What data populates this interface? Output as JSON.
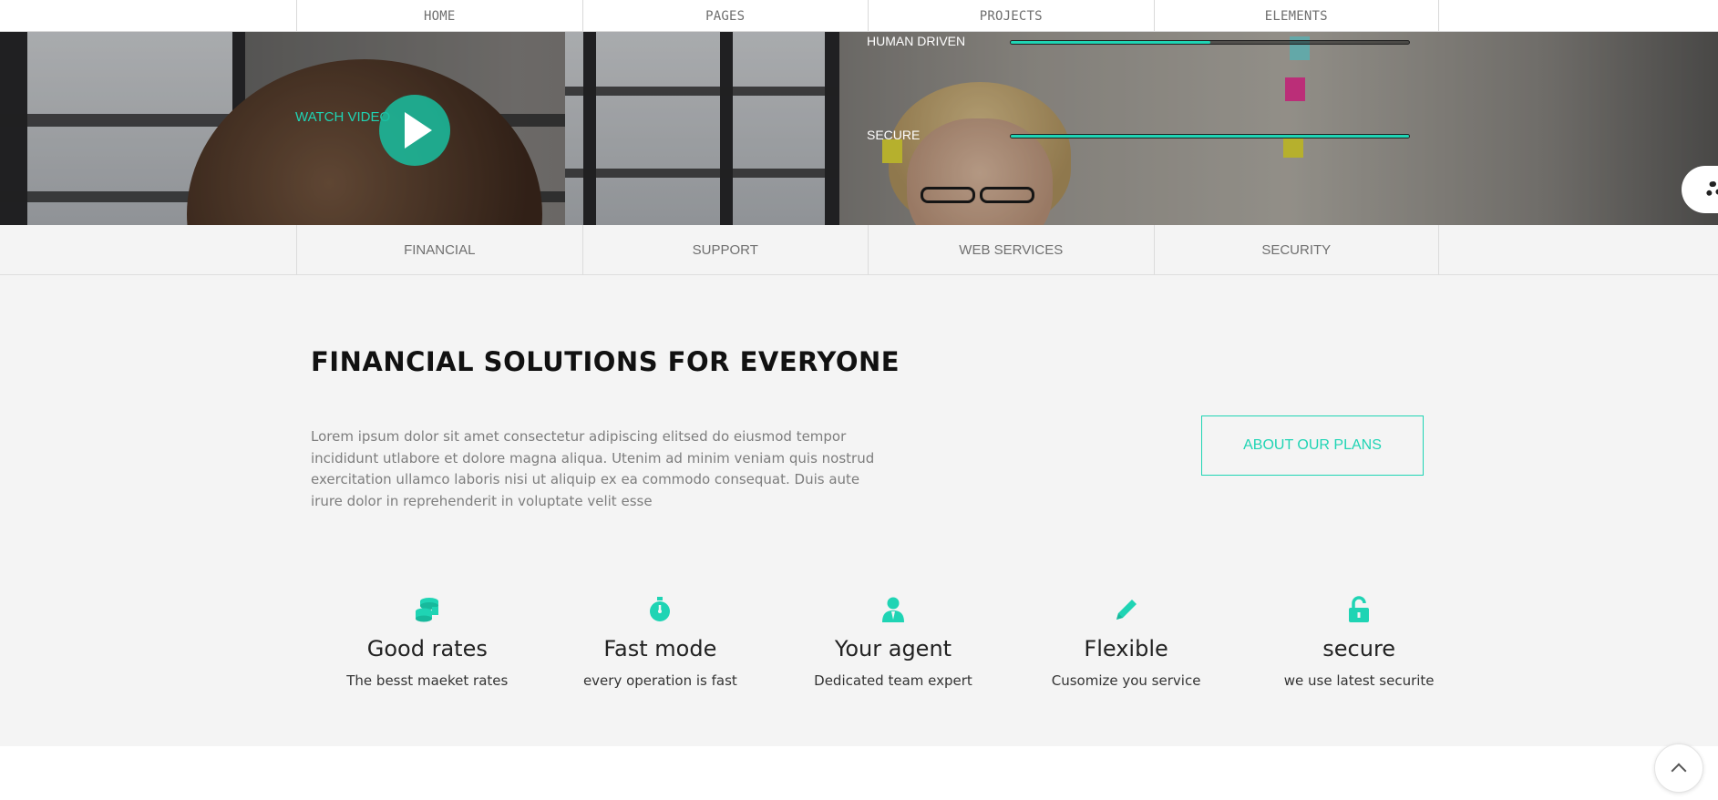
{
  "topnav": {
    "items": [
      {
        "label": "HOME"
      },
      {
        "label": "PAGES"
      },
      {
        "label": "PROJECTS"
      },
      {
        "label": "ELEMENTS"
      }
    ]
  },
  "hero": {
    "watch_label": "WATCH VIDEO",
    "skills": [
      {
        "label": "HUMAN DRIVEN",
        "level": 0.5
      },
      {
        "label": "SECURE",
        "level": 1.0
      }
    ]
  },
  "subnav": {
    "items": [
      {
        "label": "FINANCIAL"
      },
      {
        "label": "SUPPORT"
      },
      {
        "label": "WEB SERVICES"
      },
      {
        "label": "SECURITY"
      }
    ]
  },
  "main": {
    "title": "FINANCIAL SOLUTIONS FOR EVERYONE",
    "description": "Lorem ipsum dolor sit amet consectetur adipiscing elitsed do eiusmod tempor incididunt utlabore et dolore magna aliqua. Utenim ad minim veniam quis nostrud exercitation ullamco laboris nisi ut aliquip ex ea commodo consequat. Duis aute irure dolor in reprehenderit in voluptate velit esse",
    "plans_button": "ABOUT OUR PLANS"
  },
  "features": [
    {
      "icon": "coins-icon",
      "title": "Good rates",
      "subtitle": "The besst maeket rates"
    },
    {
      "icon": "stopwatch-icon",
      "title": "Fast mode",
      "subtitle": "every operation is fast"
    },
    {
      "icon": "user-icon",
      "title": "Your agent",
      "subtitle": "Dedicated team expert"
    },
    {
      "icon": "pencil-icon",
      "title": "Flexible",
      "subtitle": "Cusomize you service"
    },
    {
      "icon": "unlock-icon",
      "title": "secure",
      "subtitle": "we use latest securite"
    }
  ],
  "colors": {
    "accent": "#1fd4b4",
    "section_bg": "#f4f4f4",
    "text_dark": "#111111",
    "text_muted": "#7d7d7d"
  }
}
